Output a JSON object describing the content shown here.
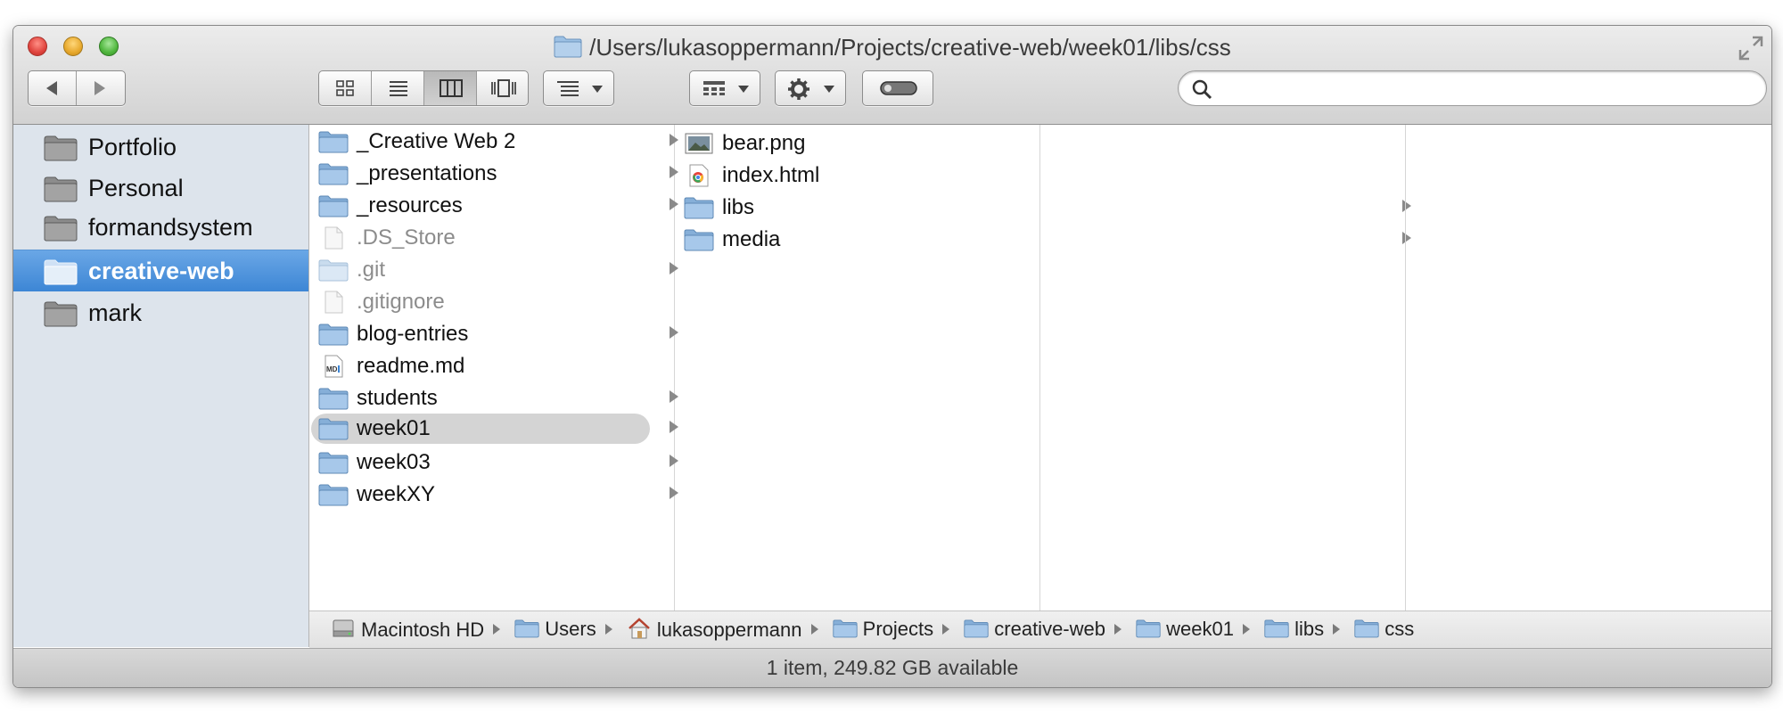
{
  "window": {
    "title": "/Users/lukasoppermann/Projects/creative-web/week01/libs/css"
  },
  "toolbar": {
    "back_icon": "back-arrow-icon",
    "forward_icon": "forward-arrow-icon",
    "view_modes": [
      "icon-view",
      "list-view",
      "column-view",
      "cover-flow-view"
    ],
    "active_view": "column-view",
    "arrange_icon": "arrange-icon",
    "share_icon": "share-grid-icon",
    "action_icon": "gear-icon",
    "toggle_icon": "toolbar-toggle-icon",
    "search": {
      "placeholder": "",
      "value": ""
    }
  },
  "sidebar": {
    "items": [
      {
        "label": "Portfolio",
        "selected": false
      },
      {
        "label": "Personal",
        "selected": false
      },
      {
        "label": "formandsystem",
        "selected": false
      },
      {
        "label": "creative-web",
        "selected": true
      },
      {
        "label": "mark",
        "selected": false
      }
    ]
  },
  "columns": [
    {
      "items": [
        {
          "name": "_Creative Web 2",
          "type": "folder",
          "arrow": true
        },
        {
          "name": "_presentations",
          "type": "folder",
          "arrow": true
        },
        {
          "name": "_resources",
          "type": "folder",
          "arrow": true
        },
        {
          "name": ".DS_Store",
          "type": "file-dim",
          "arrow": false
        },
        {
          "name": ".git",
          "type": "folder-dim",
          "arrow": true
        },
        {
          "name": ".gitignore",
          "type": "file-dim",
          "arrow": false
        },
        {
          "name": "blog-entries",
          "type": "folder",
          "arrow": true
        },
        {
          "name": "readme.md",
          "type": "md",
          "arrow": false
        },
        {
          "name": "students",
          "type": "folder",
          "arrow": true
        },
        {
          "name": "week01",
          "type": "folder",
          "arrow": true,
          "highlighted": true
        },
        {
          "name": "week03",
          "type": "folder",
          "arrow": true
        },
        {
          "name": "weekXY",
          "type": "folder",
          "arrow": true
        }
      ]
    },
    {
      "items": [
        {
          "name": "bear.png",
          "type": "image",
          "arrow": false
        },
        {
          "name": "index.html",
          "type": "html",
          "arrow": false
        },
        {
          "name": "libs",
          "type": "folder",
          "arrow": true
        },
        {
          "name": "media",
          "type": "folder",
          "arrow": true
        }
      ]
    },
    {
      "items": []
    },
    {
      "items": []
    }
  ],
  "pathbar": {
    "crumbs": [
      {
        "label": "Macintosh HD",
        "icon": "hard-drive-icon"
      },
      {
        "label": "Users",
        "icon": "folder-icon"
      },
      {
        "label": "lukasoppermann",
        "icon": "home-icon"
      },
      {
        "label": "Projects",
        "icon": "folder-icon"
      },
      {
        "label": "creative-web",
        "icon": "folder-icon"
      },
      {
        "label": "week01",
        "icon": "folder-icon"
      },
      {
        "label": "libs",
        "icon": "folder-icon"
      },
      {
        "label": "css",
        "icon": "folder-icon"
      }
    ]
  },
  "status": {
    "text": "1 item, 249.82 GB available"
  },
  "colors": {
    "selection_blue": "#3d86d5",
    "sidebar_bg": "#dde4ec",
    "folder_blue": "#8fb6dc"
  }
}
